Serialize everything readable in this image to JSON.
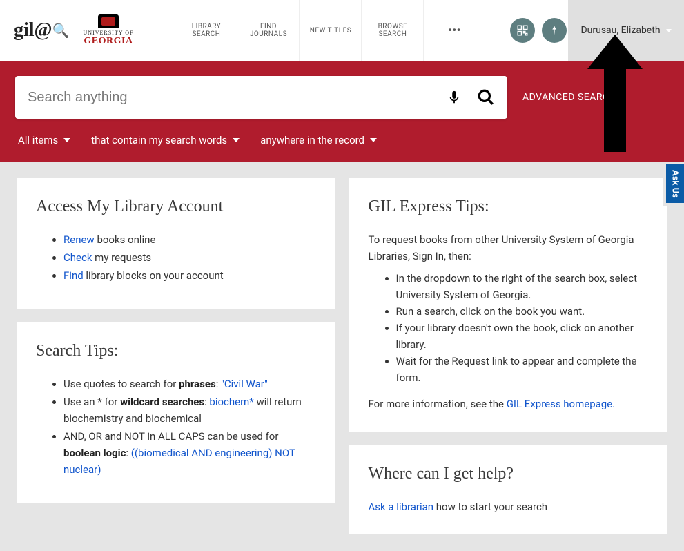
{
  "header": {
    "logo_text": "gil@",
    "uga_label1": "UNIVERSITY OF",
    "uga_label2": "GEORGIA",
    "nav": [
      {
        "line1": "LIBRARY",
        "line2": "SEARCH"
      },
      {
        "line1": "FIND",
        "line2": "JOURNALS"
      },
      {
        "line1": "NEW TITLES",
        "line2": ""
      },
      {
        "line1": "BROWSE",
        "line2": "SEARCH"
      }
    ],
    "user_name": "Durusau, Elizabeth"
  },
  "search": {
    "placeholder": "Search anything",
    "advanced_link": "ADVANCED SEARCH",
    "filters": [
      "All items",
      "that contain my search words",
      "anywhere in the record"
    ]
  },
  "left_cards": {
    "account": {
      "title": "Access My Library Account",
      "items": [
        {
          "link": "Renew",
          "rest": " books online"
        },
        {
          "link": "Check",
          "rest": " my requests"
        },
        {
          "link": "Find",
          "rest": " library blocks on your account"
        }
      ]
    },
    "search_tips": {
      "title": "Search Tips:",
      "line1_pre": "Use quotes to search for ",
      "line1_bold": "phrases",
      "line1_colon": ": ",
      "line1_link": "\"Civil War\"",
      "line2_pre": "Use an * for ",
      "line2_bold": "wildcard searches",
      "line2_colon": ": ",
      "line2_link": "biochem*",
      "line2_rest": " will return biochemistry and biochemical",
      "line3_pre": "AND, OR and NOT in ALL CAPS can be used for ",
      "line3_bold": "boolean logic",
      "line3_colon": ": ",
      "line3_link": "((biomedical AND engineering) NOT nuclear)"
    }
  },
  "right_cards": {
    "gil": {
      "title": "GIL Express Tips:",
      "intro": "To request books from other University System of Georgia Libraries, Sign In, then:",
      "steps": [
        "In the dropdown to the right of the search box, select University System of Georgia.",
        "Run a search, click on the book you want.",
        "If your library doesn't own the book, click on another library.",
        "Wait for the Request link to appear and complete the form."
      ],
      "outro_pre": "For more information, see the ",
      "outro_link": "GIL Express homepage.",
      "outro_post": ""
    },
    "help": {
      "title": "Where can I get help?",
      "link": "Ask a librarian",
      "rest": " how to start your search"
    }
  },
  "ask_us": "Ask Us"
}
